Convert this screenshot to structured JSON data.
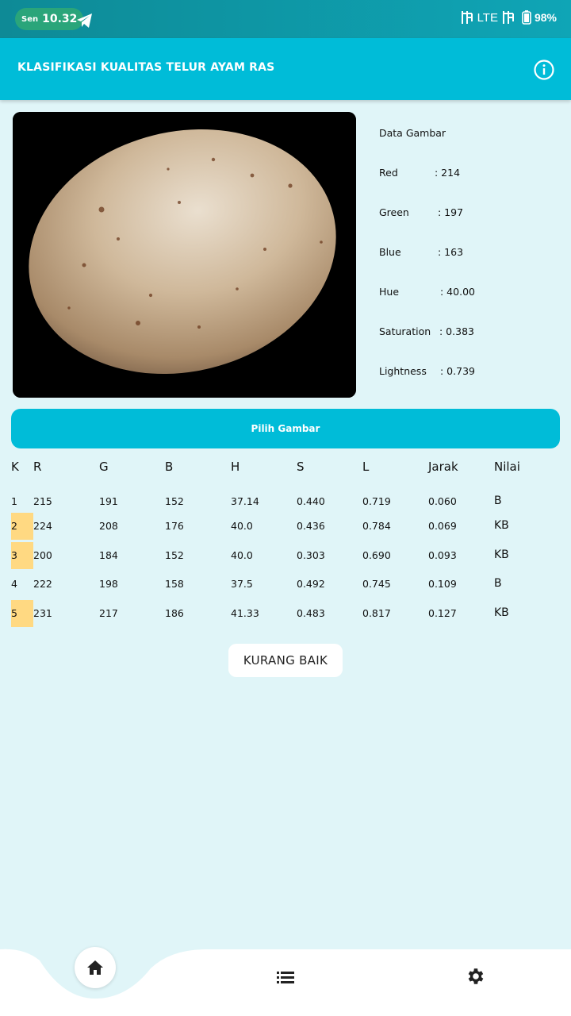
{
  "status": {
    "day": "Sen",
    "time": "10.32",
    "network": "LTE",
    "battery": "98%"
  },
  "app": {
    "title": "KLASIFIKASI KUALITAS TELUR AYAM RAS"
  },
  "icons": {
    "info": "info-icon",
    "telegram": "telegram-icon",
    "home": "home-icon",
    "list": "list-icon",
    "settings": "gear-icon"
  },
  "image_data": {
    "title": "Data Gambar",
    "rows": [
      {
        "label": "Red",
        "value": ": 214"
      },
      {
        "label": "Green",
        "value": ": 197"
      },
      {
        "label": "Blue",
        "value": ": 163"
      },
      {
        "label": "Hue",
        "value": ": 40.00"
      },
      {
        "label": "Saturation",
        "value": ": 0.383"
      },
      {
        "label": "Lightness",
        "value": ": 0.739"
      }
    ]
  },
  "pick_button": "Pilih Gambar",
  "table": {
    "headers": [
      "K",
      "R",
      "G",
      "B",
      "H",
      "S",
      "L",
      "Jarak",
      "Nilai"
    ],
    "rows": [
      {
        "k": "1",
        "r": "215",
        "g": "191",
        "b": "152",
        "h": "37.14",
        "s": "0.440",
        "l": "0.719",
        "jarak": "0.060",
        "nilai": "B",
        "highlight": false
      },
      {
        "k": "2",
        "r": "224",
        "g": "208",
        "b": "176",
        "h": "40.0",
        "s": "0.436",
        "l": "0.784",
        "jarak": "0.069",
        "nilai": "KB",
        "highlight": true
      },
      {
        "k": "3",
        "r": "200",
        "g": "184",
        "b": "152",
        "h": "40.0",
        "s": "0.303",
        "l": "0.690",
        "jarak": "0.093",
        "nilai": "KB",
        "highlight": true
      },
      {
        "k": "4",
        "r": "222",
        "g": "198",
        "b": "158",
        "h": "37.5",
        "s": "0.492",
        "l": "0.745",
        "jarak": "0.109",
        "nilai": "B",
        "highlight": false
      },
      {
        "k": "5",
        "r": "231",
        "g": "217",
        "b": "186",
        "h": "41.33",
        "s": "0.483",
        "l": "0.817",
        "jarak": "0.127",
        "nilai": "KB",
        "highlight": true
      }
    ]
  },
  "result": "KURANG BAIK",
  "colors": {
    "primary": "#00bcd8",
    "background": "#e0f5f8",
    "highlight": "#ffd982",
    "status_pill": "#2aa57a"
  }
}
